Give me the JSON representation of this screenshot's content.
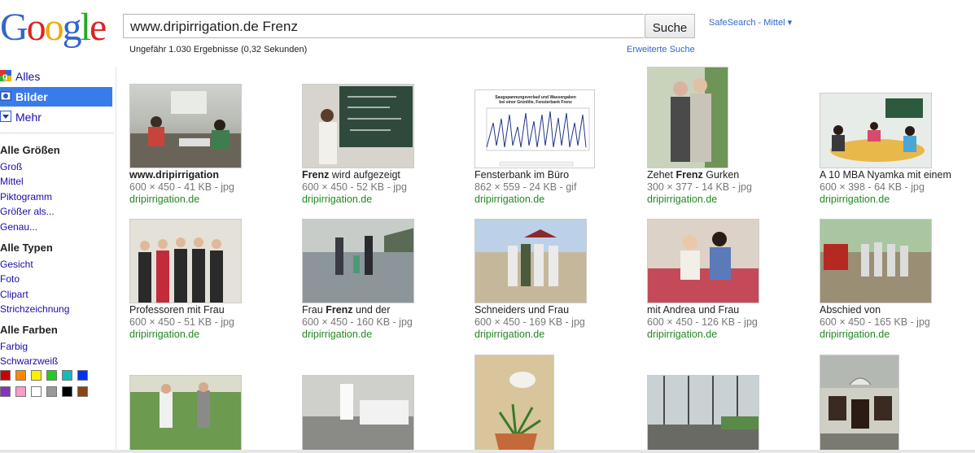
{
  "logo": {
    "letters": [
      "G",
      "o",
      "o",
      "g",
      "l",
      "e"
    ]
  },
  "search": {
    "query": "www.dripirrigation.de Frenz",
    "button_label": "Suche"
  },
  "safesearch": "SafeSearch - Mittel ▾",
  "results_count": "Ungefähr 1.030 Ergebnisse (0,32 Sekunden)",
  "advanced_search": "Erweiterte Suche",
  "nav": [
    {
      "label": "Alles",
      "icon": "alles-icon"
    },
    {
      "label": "Bilder",
      "icon": "bilder-icon"
    },
    {
      "label": "Mehr",
      "icon": "chevron-down-icon"
    }
  ],
  "filters": {
    "size": {
      "title": "Alle Größen",
      "items": [
        "Groß",
        "Mittel",
        "Piktogramm",
        "Größer als...",
        "Genau..."
      ]
    },
    "type": {
      "title": "Alle Typen",
      "items": [
        "Gesicht",
        "Foto",
        "Clipart",
        "Strichzeichnung"
      ]
    },
    "color": {
      "title": "Alle Farben",
      "items": [
        "Farbig",
        "Schwarzweiß"
      ]
    }
  },
  "swatch_colors": [
    "#cc0000",
    "#ff8800",
    "#ffee00",
    "#22cc22",
    "#11bbbb",
    "#0033ee",
    "#8833bb",
    "#ff99cc",
    "#ffffff",
    "#999999",
    "#000000",
    "#8b4513"
  ],
  "results": [
    {
      "caption_bold": "www.dripirrigation",
      "caption_rest": "",
      "meta": "600 × 450 - 41 KB - jpg",
      "domain": "dripirrigation.de"
    },
    {
      "caption_bold": "Frenz",
      "caption_rest": " wird aufgezeigt",
      "meta": "600 × 450 - 52 KB - jpg",
      "domain": "dripirrigation.de"
    },
    {
      "caption_bold": "",
      "caption_rest": "Fensterbank im Büro",
      "meta": "862 × 559 - 24 KB - gif",
      "domain": "dripirrigation.de"
    },
    {
      "caption_pre": "Zehet ",
      "caption_bold": "Frenz",
      "caption_rest": " Gurken",
      "meta": "300 × 377 - 14 KB - jpg",
      "domain": "dripirrigation.de"
    },
    {
      "caption_bold": "",
      "caption_rest": "A 10 MBA Nyamka mit einem",
      "meta": "600 × 398 - 64 KB - jpg",
      "domain": "dripirrigation.de"
    },
    {
      "caption_bold": "",
      "caption_rest": "Professoren mit Frau",
      "meta": "600 × 450 - 51 KB - jpg",
      "domain": "dripirrigation.de"
    },
    {
      "caption_pre": "Frau ",
      "caption_bold": "Frenz",
      "caption_rest": " und der",
      "meta": "600 × 450 - 160 KB - jpg",
      "domain": "dripirrigation.de"
    },
    {
      "caption_bold": "",
      "caption_rest": "Schneiders und Frau",
      "meta": "600 × 450 - 169 KB - jpg",
      "domain": "dripirrigation.de"
    },
    {
      "caption_bold": "",
      "caption_rest": "mit Andrea und Frau",
      "meta": "600 × 450 - 126 KB - jpg",
      "domain": "dripirrigation.de"
    },
    {
      "caption_bold": "",
      "caption_rest": "Abschied von",
      "meta": "600 × 450 - 165 KB - jpg",
      "domain": "dripirrigation.de"
    }
  ],
  "chart_thumb": {
    "title_line1": "Saugspannungsverlauf und Wassergaben",
    "title_line2": "bei einer Grünlilie, Fensterbank Frenz"
  }
}
